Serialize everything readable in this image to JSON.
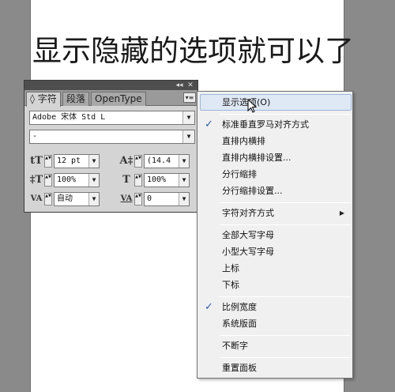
{
  "document": {
    "text": "显示隐藏的选项就可以了"
  },
  "panel": {
    "titlebar": {
      "collapse": "◂◂",
      "close": "✕"
    },
    "tabs": [
      {
        "label": "◊ 字符"
      },
      {
        "label": "段落"
      },
      {
        "label": "OpenType"
      }
    ],
    "menu_button": "▾≡",
    "font_family": "Adobe 宋体 Std L",
    "font_style": "-",
    "fields": {
      "font_size": "12 pt",
      "leading": "(14.4",
      "vertical_scale": "100%",
      "horizontal_scale": "100%",
      "kerning": "自动",
      "tracking": "0"
    },
    "icons": {
      "font_size": "tT",
      "leading": "A‡",
      "vertical_scale": "‡T",
      "horizontal_scale": "T",
      "kerning": "VA",
      "tracking": "VA"
    }
  },
  "flyout_menu": {
    "items": [
      {
        "label": "显示选项(O)",
        "checked": false
      },
      {
        "label": "标准垂直罗马对齐方式",
        "checked": true
      },
      {
        "label": "直排内横排",
        "checked": false
      },
      {
        "label": "直排内横排设置...",
        "checked": false
      },
      {
        "label": "分行缩排",
        "checked": false
      },
      {
        "label": "分行缩排设置...",
        "checked": false
      },
      {
        "label": "字符对齐方式",
        "checked": false,
        "submenu": true
      },
      {
        "label": "全部大写字母",
        "checked": false
      },
      {
        "label": "小型大写字母",
        "checked": false
      },
      {
        "label": "上标",
        "checked": false
      },
      {
        "label": "下标",
        "checked": false
      },
      {
        "label": "比例宽度",
        "checked": true
      },
      {
        "label": "系统版面",
        "checked": false
      },
      {
        "label": "不断字",
        "checked": false
      },
      {
        "label": "重置面板",
        "checked": false
      }
    ],
    "check_glyph": "✓",
    "submenu_glyph": "▶"
  },
  "glyphs": {
    "dropdown": "▼",
    "spinner": "▲▼"
  },
  "colors": {
    "highlight": "#dfe8f5",
    "check": "#2a5db0",
    "titlebar": "#4e4e4e"
  }
}
